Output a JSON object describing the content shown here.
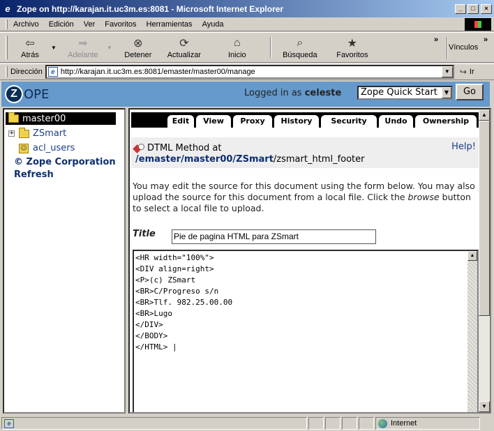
{
  "window": {
    "title": "Zope on http://karajan.it.uc3m.es:8081 - Microsoft Internet Explorer",
    "controls": [
      "_",
      "□",
      "×"
    ]
  },
  "menubar": {
    "items": [
      "Archivo",
      "Edición",
      "Ver",
      "Favoritos",
      "Herramientas",
      "Ayuda"
    ]
  },
  "toolbar": {
    "back": "Atrás",
    "forward": "Adelante",
    "stop": "Detener",
    "refresh": "Actualizar",
    "home": "Inicio",
    "search": "Búsqueda",
    "favorites": "Favoritos",
    "links": "Vínculos",
    "more": "»"
  },
  "address": {
    "label": "Dirección",
    "url": "http://karajan.it.uc3m.es:8081/emaster/master00/manage",
    "go": "Ir"
  },
  "zope_header": {
    "logo_letter": "Z",
    "logo_text": "OPE",
    "logged_prefix": "Logged in as",
    "user": "celeste",
    "quick_start": "Zope Quick Start",
    "go_button": "Go"
  },
  "tree": {
    "root": "master00",
    "expander": "+",
    "items": [
      "ZSmart",
      "acl_users"
    ],
    "links": [
      "© Zope Corporation",
      "Refresh"
    ]
  },
  "tabs": [
    "Edit",
    "View",
    "Proxy",
    "History",
    "Security",
    "Undo",
    "Ownership"
  ],
  "object": {
    "type": "DTML Method at",
    "help": "Help!",
    "path_parts": [
      "/emaster",
      "/master00",
      "/ZSmart"
    ],
    "id": "/zsmart_html_footer"
  },
  "intro": {
    "before": "You may edit the source for this document using the form below. You may also upload the source for this document from a local file. Click the ",
    "em": "browse",
    "after": " button to select a local file to upload."
  },
  "form": {
    "title_label": "Title",
    "title_value": "Pie de pagina HTML para ZSmart",
    "source": "<HR width=\"100%\">\n<DIV align=right>\n<P>(c) ZSmart\n<BR>C/Progreso s/n\n<BR>Tlf. 982.25.00.00\n<BR>Lugo\n</DIV>\n</BODY>\n</HTML> |"
  },
  "statusbar": {
    "zone": "Internet"
  }
}
